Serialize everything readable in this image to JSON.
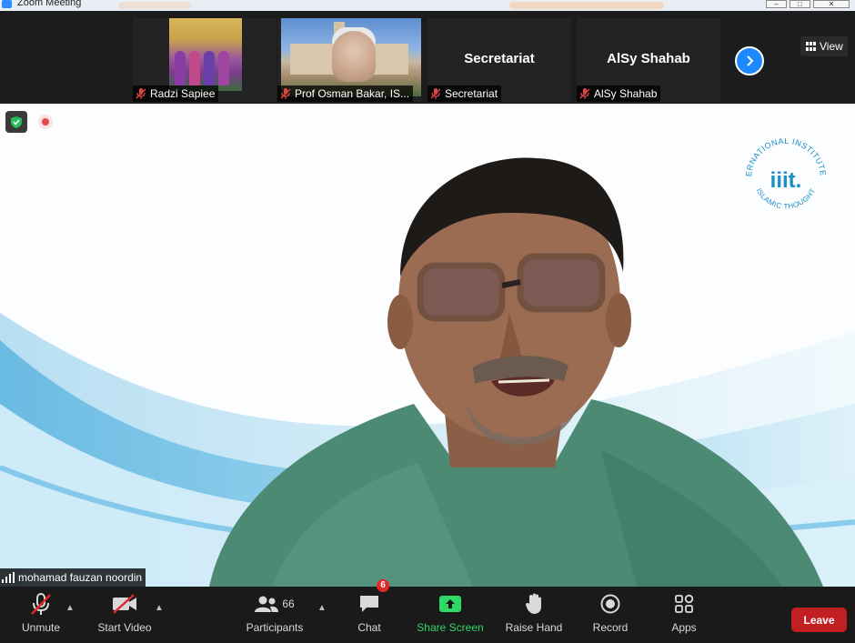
{
  "window": {
    "title": "Zoom Meeting",
    "controls": {
      "minimize": "–",
      "maximize": "□",
      "close": "✕"
    }
  },
  "gallery": {
    "tiles": [
      {
        "name": "Radzi Sapiee",
        "muted": true,
        "kind": "photo"
      },
      {
        "name": "Prof Osman Bakar, IS...",
        "muted": true,
        "kind": "photo"
      },
      {
        "name": "Secretariat",
        "center_name": "Secretariat",
        "muted": true,
        "kind": "name"
      },
      {
        "name": "AlSy Shahab",
        "center_name": "AlSy Shahab",
        "muted": true,
        "kind": "name"
      }
    ],
    "next_icon": "chevron-right-icon",
    "view_label": "View"
  },
  "main_video": {
    "speaker_name": "mohamad fauzan noordin",
    "logo_text_top": "INTERNATIONAL INSTITUTE OF",
    "logo_text_bottom": "ISLAMIC THOUGHT",
    "logo_mark": "iiit.",
    "brand_color": "#1a8fc9"
  },
  "toolbar": {
    "unmute_label": "Unmute",
    "start_video_label": "Start Video",
    "participants_label": "Participants",
    "participants_count": "66",
    "chat_label": "Chat",
    "chat_badge": "6",
    "share_label": "Share Screen",
    "raise_hand_label": "Raise Hand",
    "record_label": "Record",
    "apps_label": "Apps",
    "leave_label": "Leave",
    "share_color": "#2ed864",
    "leave_color": "#c21f23"
  }
}
